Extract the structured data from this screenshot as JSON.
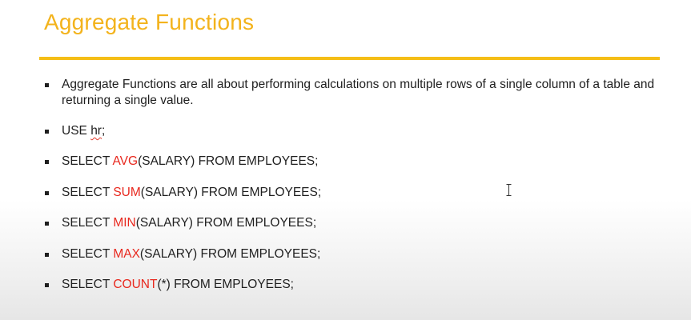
{
  "slide": {
    "title": "Aggregate Functions",
    "accent_color": "#f5be17",
    "keyword_color": "#e8281e",
    "bullets": [
      {
        "text": "Aggregate Functions are all about performing  calculations on multiple rows of a single column of a table and returning a single value."
      },
      {
        "prefix": "USE ",
        "word": "hr",
        "suffix": ";"
      },
      {
        "prefix": "SELECT ",
        "keyword": "AVG",
        "suffix": "(SALARY) FROM EMPLOYEES;"
      },
      {
        "prefix": "SELECT ",
        "keyword": "SUM",
        "suffix": "(SALARY) FROM EMPLOYEES;"
      },
      {
        "prefix": "SELECT ",
        "keyword": "MIN",
        "suffix": "(SALARY) FROM EMPLOYEES;"
      },
      {
        "prefix": "SELECT ",
        "keyword": "MAX",
        "suffix": "(SALARY) FROM EMPLOYEES;"
      },
      {
        "prefix": "SELECT ",
        "keyword": "COUNT",
        "suffix": "(*) FROM EMPLOYEES;"
      }
    ]
  },
  "cursor": {
    "icon": "text-cursor-icon"
  }
}
